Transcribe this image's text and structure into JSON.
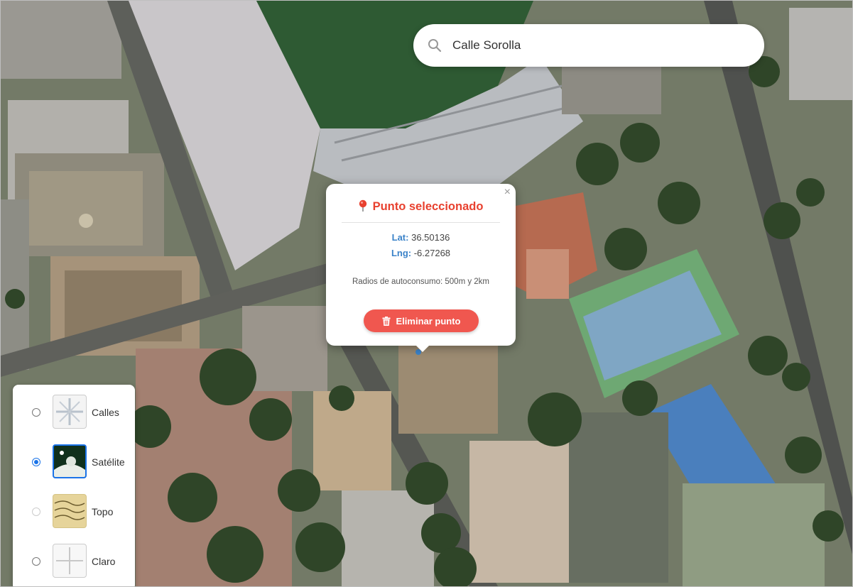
{
  "search": {
    "value": "Calle Sorolla",
    "icon": "search-icon"
  },
  "popup": {
    "title": "Punto seleccionado",
    "close_label": "×",
    "lat_label": "Lat:",
    "lat_value": "36.50136",
    "lng_label": "Lng:",
    "lng_value": "-6.27268",
    "note": "Radios de autoconsumo: 500m y 2km",
    "delete_label": "Eliminar punto",
    "accent_color": "#e8412f",
    "button_color": "#f0574f"
  },
  "layers": [
    {
      "label": "Calles",
      "selected": false
    },
    {
      "label": "Satélite",
      "selected": true
    },
    {
      "label": "Topo",
      "selected": false
    },
    {
      "label": "Claro",
      "selected": false
    }
  ]
}
